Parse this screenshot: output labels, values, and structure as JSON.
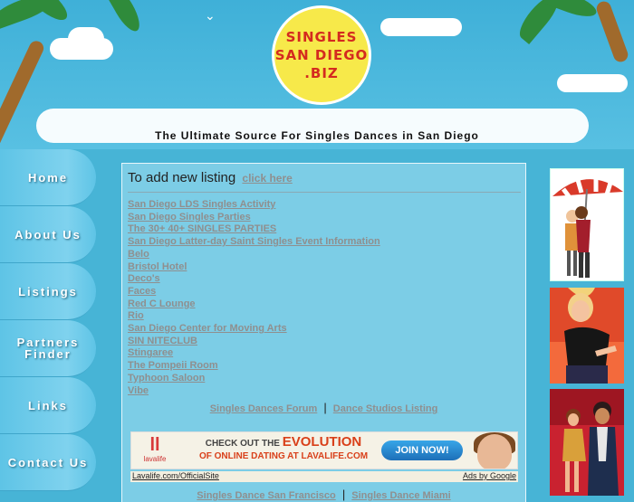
{
  "header": {
    "logo_lines": [
      "SINGLES",
      "SAN DIEGO",
      ".BIZ"
    ],
    "tagline": "The Ultimate Source For Singles Dances in San Diego"
  },
  "nav": {
    "items": [
      {
        "label": "Home"
      },
      {
        "label": "About Us"
      },
      {
        "label": "Listings"
      },
      {
        "label": "Partners Finder"
      },
      {
        "label": "Links"
      },
      {
        "label": "Contact Us"
      }
    ]
  },
  "main": {
    "add_prompt": "To add new listing",
    "add_link": "click here",
    "listings": [
      "San Diego LDS Singles Activity",
      "San Diego Singles Parties",
      "The 30+ 40+ SINGLES PARTIES",
      "San Diego Latter-day Saint Singles Event Information",
      "Belo",
      "Bristol Hotel",
      "Deco's",
      "Faces",
      "Red C Lounge",
      "Rio",
      "San Diego Center for Moving Arts",
      "SIN NITECLUB",
      "Stingaree",
      "The Pompeii Room",
      "Typhoon Saloon",
      "Vibe"
    ],
    "forum_link": "Singles Dances Forum",
    "studios_link": "Dance Studios Listing",
    "separator": "|",
    "ad": {
      "logo": "lavalife",
      "line1_pre": "CHECK OUT THE",
      "line1_emph": "EVOLUTION",
      "line2": "OF ONLINE DATING AT LAVALIFE.COM",
      "button": "JOIN NOW!",
      "url": "Lavalife.com/OfficialSite",
      "ads_by": "Ads by Google"
    },
    "bottom_links": [
      "Singles Dance San Francisco",
      "Singles Dance Miami"
    ]
  },
  "colors": {
    "sky": "#47b4d6",
    "link_gray": "#8f8f8f",
    "logo_red": "#d42a1f",
    "sun_yellow": "#f7e94a"
  }
}
